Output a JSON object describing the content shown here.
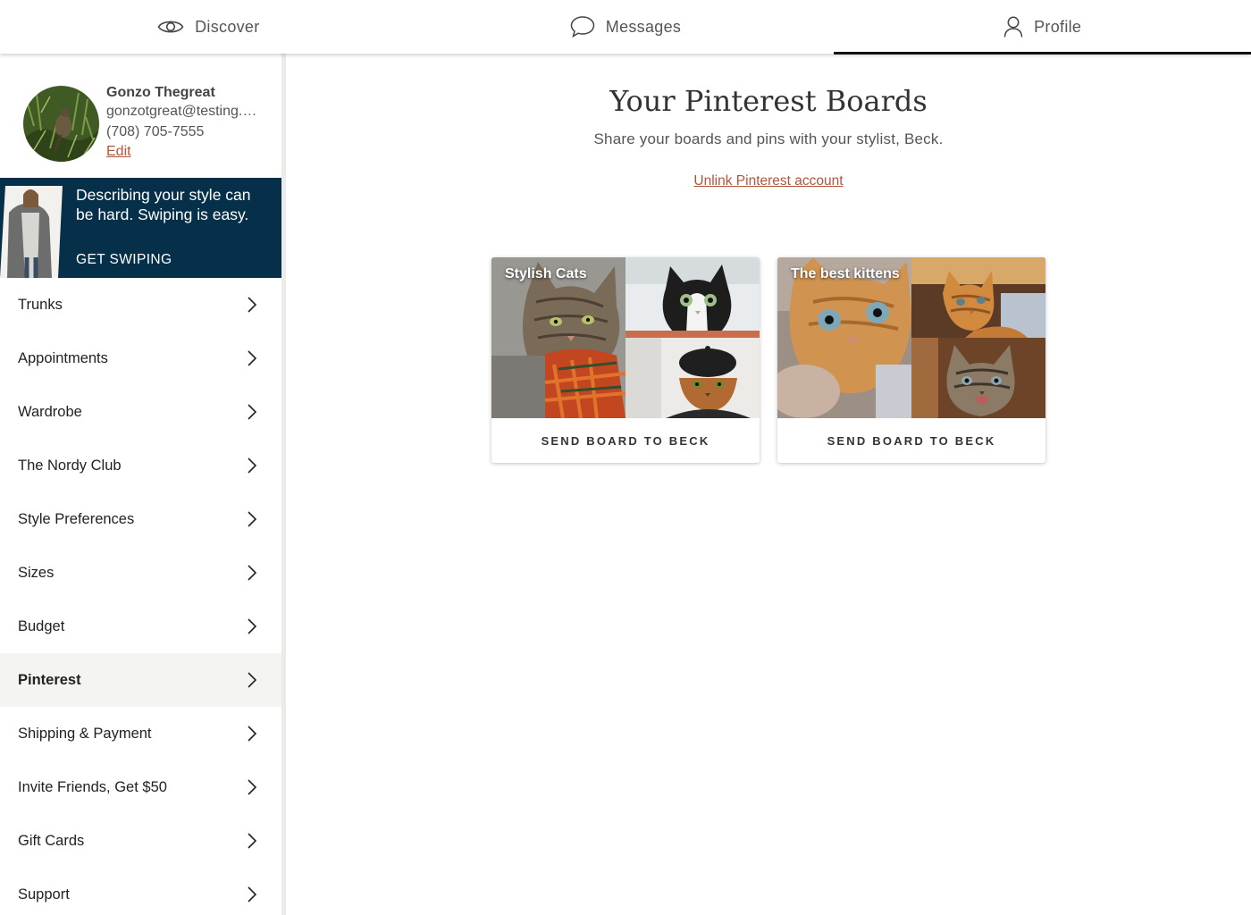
{
  "nav": {
    "tabs": [
      {
        "label": "Discover",
        "icon": "eye-icon"
      },
      {
        "label": "Messages",
        "icon": "chat-bubble-icon"
      },
      {
        "label": "Profile",
        "icon": "person-icon",
        "active": true
      }
    ]
  },
  "profile": {
    "name": "Gonzo Thegreat",
    "email": "gonzotgreat@testing.…",
    "phone": "(708) 705-7555",
    "edit_label": "Edit"
  },
  "promo": {
    "text": "Describing your style can be hard. Swiping is easy.",
    "cta": "GET SWIPING"
  },
  "menu": {
    "items": [
      {
        "label": "Trunks"
      },
      {
        "label": "Appointments"
      },
      {
        "label": "Wardrobe"
      },
      {
        "label": "The Nordy Club"
      },
      {
        "label": "Style Preferences"
      },
      {
        "label": "Sizes"
      },
      {
        "label": "Budget"
      },
      {
        "label": "Pinterest",
        "active": true
      },
      {
        "label": "Shipping & Payment"
      },
      {
        "label": "Invite Friends, Get $50"
      },
      {
        "label": "Gift Cards"
      },
      {
        "label": "Support"
      }
    ]
  },
  "main": {
    "title": "Your Pinterest Boards",
    "subtitle": "Share your boards and pins with your stylist, Beck.",
    "unlink_label": "Unlink Pinterest account",
    "boards": [
      {
        "title": "Stylish Cats",
        "button_label": "SEND BOARD TO BECK"
      },
      {
        "title": "The best kittens",
        "button_label": "SEND BOARD TO BECK"
      }
    ]
  },
  "colors": {
    "accent_link": "#b0553a",
    "promo_bg": "#06304a",
    "active_item_bg": "#f4f4f1"
  }
}
